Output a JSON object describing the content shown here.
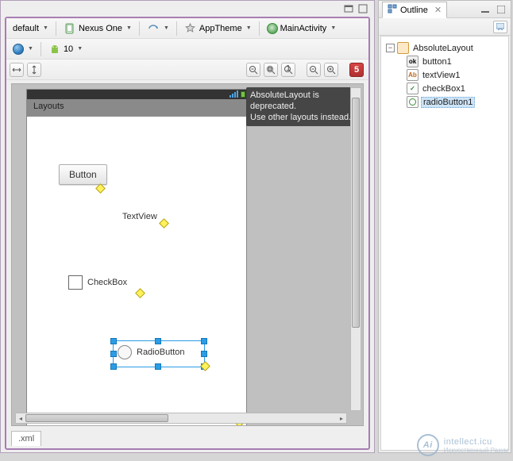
{
  "editor": {
    "toolbar1": {
      "config": "default",
      "device": "Nexus One",
      "theme": "AppTheme",
      "activity": "MainActivity"
    },
    "toolbar2": {
      "api_level": "10"
    },
    "zoom": {
      "error_count": "5"
    },
    "canvas": {
      "app_title": "Layouts",
      "info_line1": "AbsoluteLayout is deprecated.",
      "info_line2": "Use other layouts instead.",
      "widgets": {
        "button_label": "Button",
        "textview_label": "TextView",
        "checkbox_label": "CheckBox",
        "radiobutton_label": "RadioButton"
      }
    },
    "footer_tab": ".xml"
  },
  "outline": {
    "title": "Outline",
    "tree": {
      "root": "AbsoluteLayout",
      "children": [
        {
          "id": "button1"
        },
        {
          "id": "textView1"
        },
        {
          "id": "checkBox1"
        },
        {
          "id": "radioButton1"
        }
      ]
    }
  },
  "watermark": {
    "brand": "intellect.icu",
    "tagline": "Искусственный Разум"
  }
}
